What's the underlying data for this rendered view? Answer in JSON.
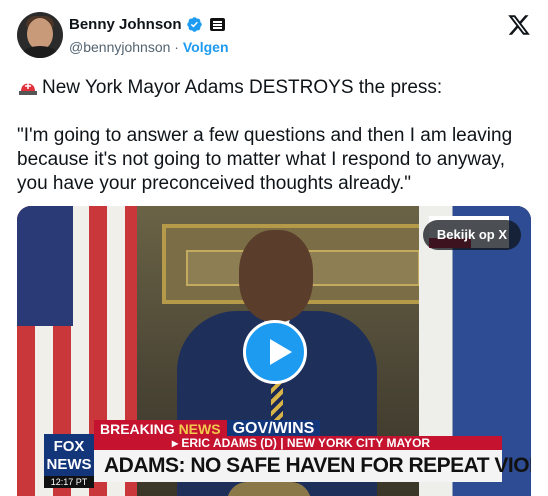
{
  "author": {
    "name": "Benny Johnson",
    "handle": "@bennyjohnson",
    "separator": "·",
    "follow_label": "Volgen"
  },
  "icons": {
    "verified": "verified-badge-icon",
    "affiliate": "affiliate-badge-icon",
    "platform": "x-logo-icon",
    "siren": "siren-emoji-icon",
    "play": "play-icon"
  },
  "colors": {
    "accent": "#1d9bf0",
    "text": "#0f1419",
    "muted": "#536471"
  },
  "tweet": {
    "line1": "New York Mayor Adams DESTROYS the press:",
    "quote": "\"I'm going to answer a few questions and then I am leaving because it's not going to matter what I respond to anyway, you have your preconceived thoughts already.\""
  },
  "media": {
    "view_label": "Bekijk op X",
    "chyron": {
      "breaking": "BREAKING",
      "news": "NEWS",
      "topic": "GOV/WINS",
      "name_line": "▸ ERIC ADAMS (D) | NEW YORK CITY MAYOR",
      "headline": "ADAMS: NO SAFE HAVEN FOR REPEAT VIOLENT CRIMINALS",
      "logo_top": "FOX",
      "logo_bottom": "NEWS",
      "time": "12:17 PT"
    }
  }
}
